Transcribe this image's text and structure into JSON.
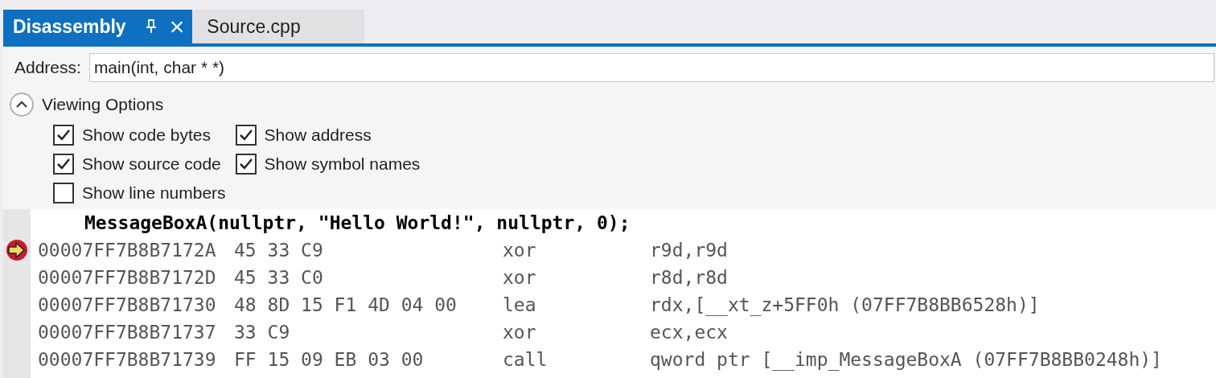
{
  "tabs": [
    {
      "label": "Disassembly",
      "selected": true,
      "close": "×"
    },
    {
      "label": "Source.cpp",
      "selected": false
    }
  ],
  "address": {
    "label": "Address:",
    "value": "main(int, char * *)"
  },
  "viewing_options": {
    "title": "Viewing Options",
    "expanded": true,
    "options": [
      {
        "label": "Show code bytes",
        "checked": true
      },
      {
        "label": "Show address",
        "checked": true
      },
      {
        "label": "Show source code",
        "checked": true
      },
      {
        "label": "Show symbol names",
        "checked": true
      },
      {
        "label": "Show line numbers",
        "checked": false
      }
    ]
  },
  "lines": [
    {
      "kind": "source",
      "text": "MessageBoxA(nullptr, \"Hello World!\", nullptr, 0);"
    },
    {
      "kind": "instruction",
      "current": true,
      "address": "00007FF7B8B7172A",
      "bytes": "45 33 C9",
      "mnemonic": "xor",
      "operands": "r9d,r9d"
    },
    {
      "kind": "instruction",
      "current": false,
      "address": "00007FF7B8B7172D",
      "bytes": "45 33 C0",
      "mnemonic": "xor",
      "operands": "r8d,r8d"
    },
    {
      "kind": "instruction",
      "current": false,
      "address": "00007FF7B8B71730",
      "bytes": "48 8D 15 F1 4D 04 00",
      "mnemonic": "lea",
      "operands": "rdx,[__xt_z+5FF0h (07FF7B8BB6528h)]"
    },
    {
      "kind": "instruction",
      "current": false,
      "address": "00007FF7B8B71737",
      "bytes": "33 C9",
      "mnemonic": "xor",
      "operands": "ecx,ecx"
    },
    {
      "kind": "instruction",
      "current": false,
      "address": "00007FF7B8B71739",
      "bytes": "FF 15 09 EB 03 00",
      "mnemonic": "call",
      "operands": "qword ptr [__imp_MessageBoxA (07FF7B8BB0248h)]"
    }
  ]
}
